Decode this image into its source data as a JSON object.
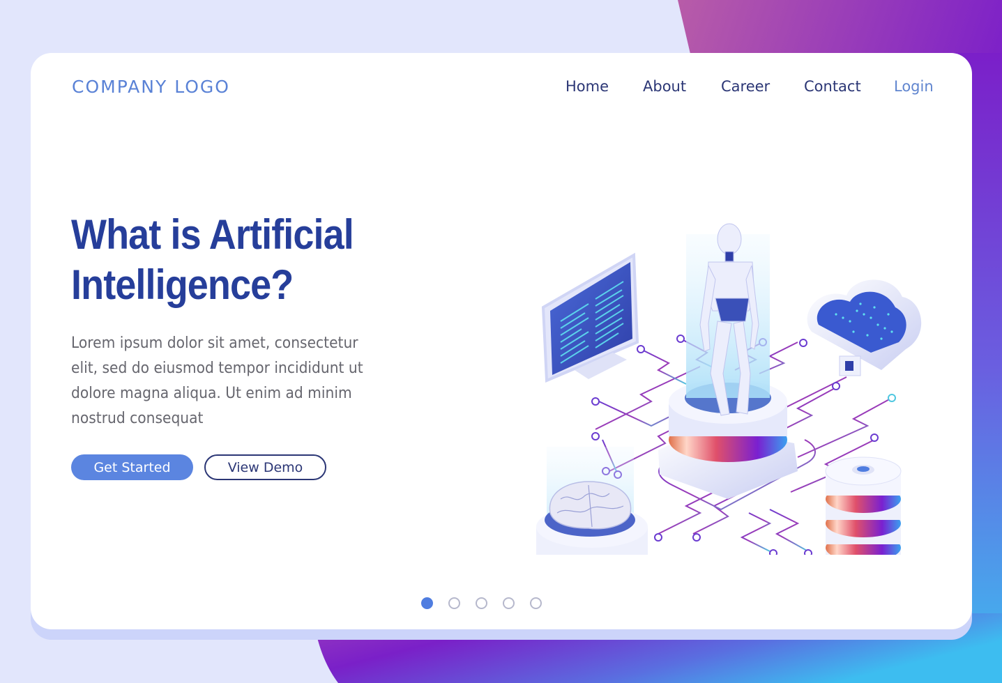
{
  "colors": {
    "background": "#e2e6fc",
    "accent": "#5b85e0",
    "heading": "#263e9a",
    "nav_text": "#2b3675",
    "login_text": "#6085cf",
    "body_text": "#66666e",
    "gradient_pink": "#b85ca8",
    "gradient_purple": "#7b1fc9",
    "gradient_blue": "#3dbdf0"
  },
  "header": {
    "logo": "COMPANY LOGO",
    "nav": [
      {
        "label": "Home"
      },
      {
        "label": "About"
      },
      {
        "label": "Career"
      },
      {
        "label": "Contact"
      },
      {
        "label": "Login"
      }
    ]
  },
  "hero": {
    "title_line1": "What is Artificial",
    "title_line2": "Intelligence?",
    "body": "Lorem ipsum dolor sit amet, consectetur elit, sed do eiusmod tempor incididunt ut dolore magna aliqua. Ut enim ad minim nostrud consequat",
    "body_lines": [
      "Lorem ipsum dolor sit amet, consectetur",
      "elit, sed do eiusmod tempor incididunt ut",
      "dolore magna aliqua. Ut enim ad minim",
      "nostrud consequat"
    ],
    "primary_button": "Get Started",
    "secondary_button": "View Demo"
  },
  "illustration": {
    "elements": [
      "monitor-with-code",
      "robot-on-pedestal",
      "cloud-storage",
      "brain-on-pedestal",
      "database-stack",
      "circuit-lines"
    ]
  },
  "pagination": {
    "total": 5,
    "active_index": 0
  }
}
